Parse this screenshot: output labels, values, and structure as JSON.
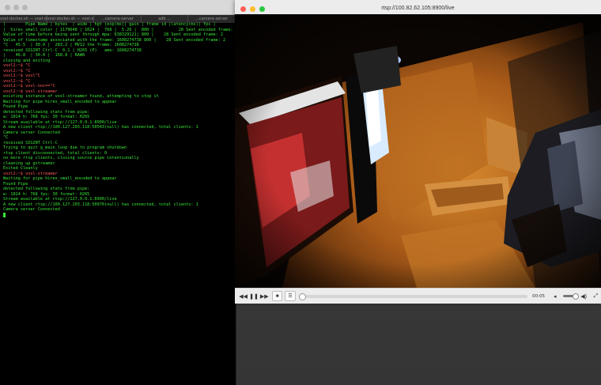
{
  "terminal": {
    "tabs": [
      "voxl-docker.sh — voxl-docker — voxl-cross",
      "voxl-docker.sh — voxl-docker — voxl-cross",
      "...camera-server",
      "adb ...",
      "...camera server"
    ],
    "lines": [
      {
        "text": "|        Pipe Name | bytes  | wide | hgt |exp(ms)| gain | frame id |latency(ms)| fps |",
        "type": "out"
      },
      {
        "text": "|  hires_small_color | 1179648 | 1024 |  768 |  5.26 |  800 |          28 Sent encoded frame: 2",
        "type": "out"
      },
      {
        "text": "Value of time before being sent through mpa: 638329121| 800 |    28 Sent encoded frame: 2",
        "type": "out"
      },
      {
        "text": "Value of timestamp associated with the frame: 1608274738 800 |    28 Sent encoded frame: 2",
        "type": "out"
      },
      {
        "text": "^C   45.5  | 30.0 |  283.2 | MV12 the frame: 1608274738",
        "type": "out"
      },
      {
        "text": "received SIGINT Ctrl-C  0.1 | H265 (P)   ame: 1608274738",
        "type": "out"
      },
      {
        "text": "|    46.8  | 30.0 |  168.8 | RAW8",
        "type": "out"
      },
      {
        "text": "closing and exiting",
        "type": "out"
      },
      {
        "text": "voxl2:~$ ^C",
        "type": "prompt"
      },
      {
        "text": "voxl2:~$ ^C",
        "type": "prompt"
      },
      {
        "text": "voxl2:~$ voxl^C",
        "type": "prompt"
      },
      {
        "text": "voxl2:~$ ^C",
        "type": "prompt"
      },
      {
        "text": "voxl2:~$ voxl-onc==^C",
        "type": "prompt"
      },
      {
        "text": "voxl2:~$ voxl-streamer",
        "type": "prompt"
      },
      {
        "text": "existing instance of voxl-streamer found, attempting to stop it",
        "type": "out"
      },
      {
        "text": "Waiting for pipe hires_small_encoded to appear",
        "type": "out"
      },
      {
        "text": "Found Pipe",
        "type": "out"
      },
      {
        "text": "detected following stats from pipe:",
        "type": "out"
      },
      {
        "text": "w: 1024 h: 768 fps: 30 format: H265",
        "type": "out"
      },
      {
        "text": "Stream available at rtsp://127.0.0.1:8900/live",
        "type": "out"
      },
      {
        "text": "A new client rtsp://100.127.203.118:50543(null) has connected, total clients: 1",
        "type": "out"
      },
      {
        "text": "Camera server Connected",
        "type": "out"
      },
      {
        "text": "^C",
        "type": "out"
      },
      {
        "text": "received SIGINT Ctrl-C",
        "type": "out"
      },
      {
        "text": "Trying to quit g_main_loop due to program shutdown",
        "type": "out"
      },
      {
        "text": "rtsp client disconnected, total clients: 0",
        "type": "out"
      },
      {
        "text": "no more rtsp clients, closing source pipe intentionally",
        "type": "out"
      },
      {
        "text": "cleaning up gstreamer",
        "type": "out"
      },
      {
        "text": "Exited Cleanly",
        "type": "out"
      },
      {
        "text": "voxl2:~$ voxl-streamer",
        "type": "prompt"
      },
      {
        "text": "Waiting for pipe hires_small_encoded to appear",
        "type": "out"
      },
      {
        "text": "Found Pipe",
        "type": "out"
      },
      {
        "text": "detected following stats from pipe:",
        "type": "out"
      },
      {
        "text": "w: 1024 h: 768 fps: 30 format: H265",
        "type": "out"
      },
      {
        "text": "Stream available at rtsp://127.0.0.1:8900/live",
        "type": "out"
      },
      {
        "text": "A new client rtsp://100.127.203.118:50970(null) has connected, total clients: 1",
        "type": "out"
      },
      {
        "text": "Camera server Connected",
        "type": "out"
      }
    ]
  },
  "vlc": {
    "title": "rtsp://100.82.62.105:8900/live",
    "time": "00:05",
    "seek_fraction": 0.0,
    "volume_fraction": 0.75,
    "controls": [
      "rewind-icon",
      "pause-icon",
      "fast-forward-icon",
      "stop-icon",
      "playlist-icon"
    ]
  },
  "colors": {
    "terminal_text": "#39e639",
    "prompt": "#ff5a5a",
    "video_warm": "#c9741f"
  }
}
